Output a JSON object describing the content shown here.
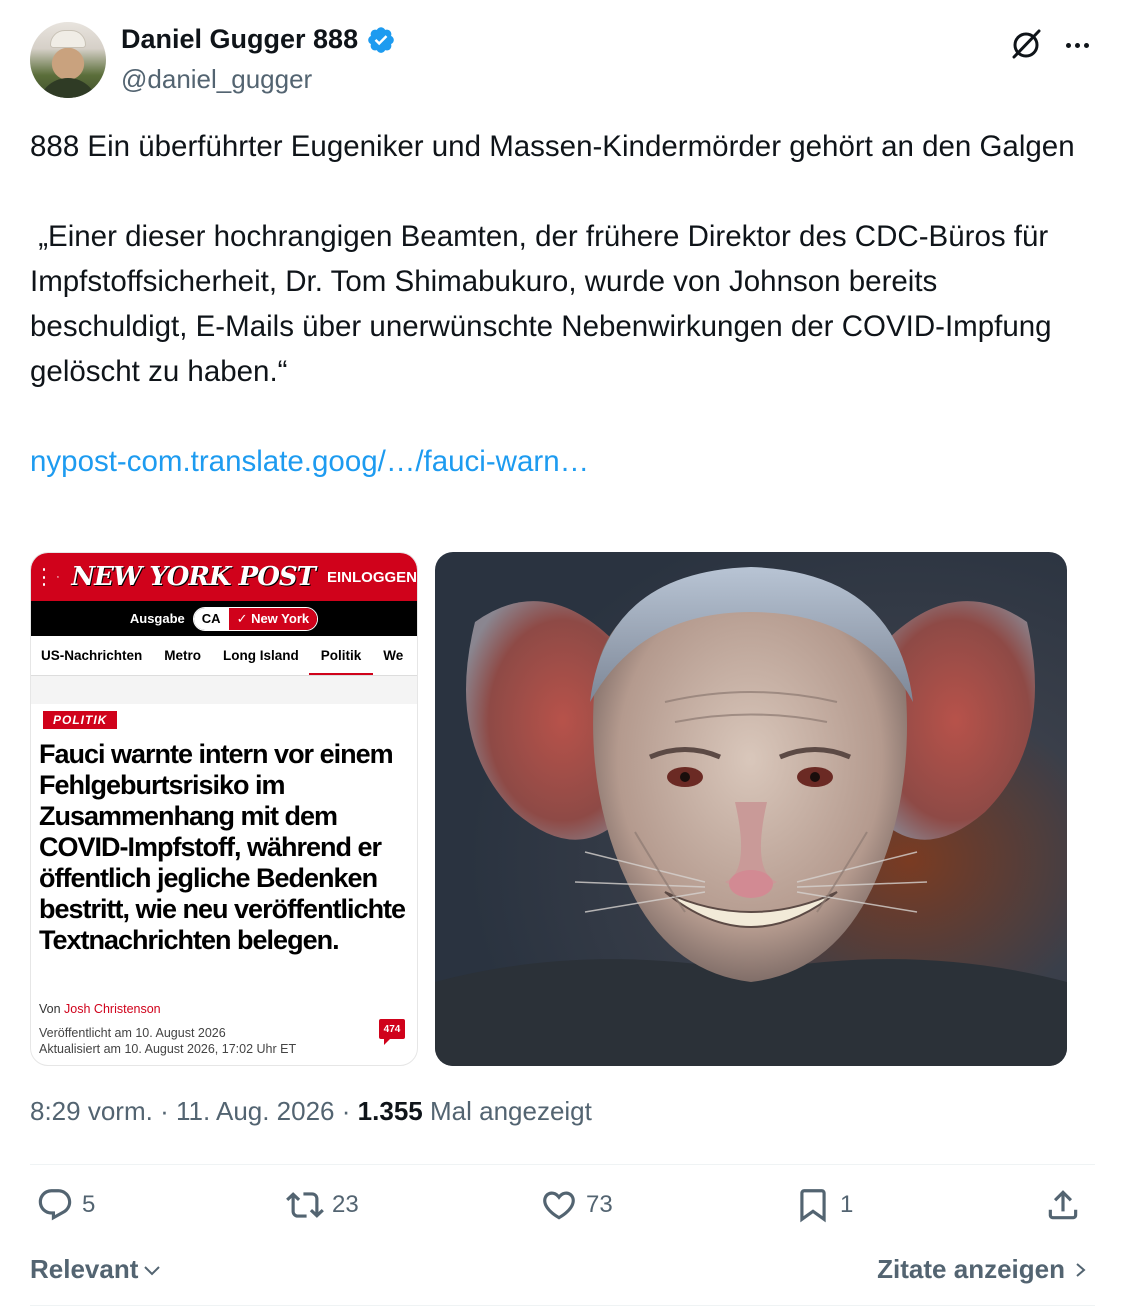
{
  "author": {
    "display_name": "Daniel Gugger 888",
    "handle": "@daniel_gugger",
    "verified": true,
    "verified_color": "#1d9bf0"
  },
  "tweet": {
    "line1": "888 Ein überführter Eugeniker und Massen-Kindermörder gehört an den Galgen",
    "quote": " „Einer dieser hochrangigen Beamten, der frühere Direktor des CDC-Büros für Impfstoffsicherheit, Dr. Tom Shimabukuro, wurde von Johnson bereits beschuldigt, E-Mails über unerwünschte Nebenwirkungen der COVID-Impfung gelöscht zu haben.“",
    "link_text": "nypost-com.translate.goog/…/fauci-warn…",
    "link_color": "#1d9bf0"
  },
  "news_card": {
    "logo": "NEW YORK POST",
    "login": "EINLOGGEN",
    "edition_label": "Ausgabe",
    "edition_ca": "CA",
    "edition_ny": "✓ New York",
    "nav": [
      "US-Nachrichten",
      "Metro",
      "Long Island",
      "Politik",
      "We"
    ],
    "section_badge": "POLITIK",
    "headline": "Fauci warnte intern vor einem Fehlgeburtsrisiko im Zusammenhang mit dem COVID-Impfstoff, während er öffentlich jegliche Bedenken bestritt, wie neu veröffentlichte Textnachrichten belegen.",
    "byline_prefix": "Von",
    "author": "Josh Christenson",
    "published": "Veröffentlicht am 10. August 2026",
    "updated": "Aktualisiert am 10. August 2026, 17:02 Uhr ET",
    "comments": "474",
    "brand_color": "#d0021b"
  },
  "meta": {
    "time": "8:29 vorm.",
    "sep1": "·",
    "date": "11. Aug. 2026",
    "sep2": "·",
    "views": "1.355",
    "views_label": "Mal angezeigt"
  },
  "actions": {
    "replies": "5",
    "reposts": "23",
    "likes": "73",
    "bookmarks": "1"
  },
  "footer": {
    "sort_label": "Relevant",
    "quotes_label": "Zitate anzeigen"
  }
}
